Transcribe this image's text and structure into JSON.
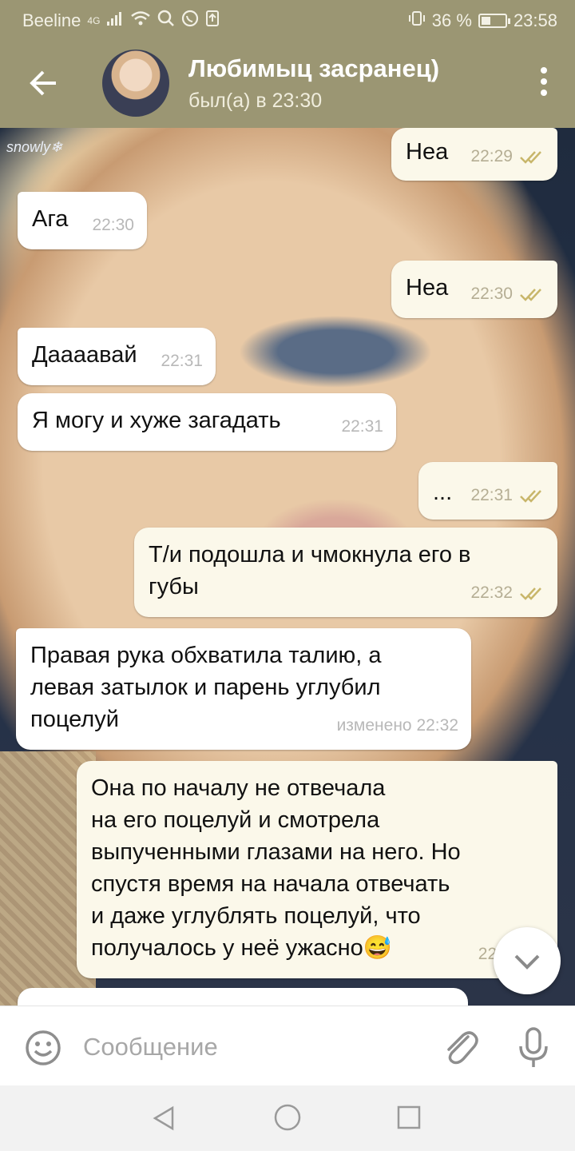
{
  "status_bar": {
    "carrier": "Beeline",
    "network": "4G",
    "battery": "36 %",
    "battery_level": 0.36,
    "time": "23:58"
  },
  "header": {
    "title": "Любимыц засранец)",
    "subtitle": "был(а) в 23:30"
  },
  "background_text": "snowly❄",
  "messages": [
    {
      "direction": "out",
      "text": "Неа",
      "time": "22:29",
      "read": true
    },
    {
      "direction": "in",
      "text": "Ага",
      "time": "22:30"
    },
    {
      "direction": "out",
      "text": "Неа",
      "time": "22:30",
      "read": true
    },
    {
      "direction": "in",
      "text": "Даааавай",
      "time": "22:31"
    },
    {
      "direction": "in",
      "text": "Я могу и хуже загадать",
      "time": "22:31"
    },
    {
      "direction": "out",
      "text": "...",
      "time": "22:31",
      "read": true
    },
    {
      "direction": "out",
      "text": "Т/и подошла и чмокнула его в\nгубы",
      "time": "22:32",
      "read": true
    },
    {
      "direction": "in",
      "text": "Правая рука обхватила талию,  а\nлевая затылок и парень углубил\nпоцелуй",
      "time": "изменено 22:32"
    },
    {
      "direction": "out",
      "text": "Она по началу не отвечала\nна его поцелуй и смотрела\nвыпученными глазами на него. Но\nспустя время на начала отвечать\nи даже углублять поцелуй, что\nполучалось у неё ужасно😅",
      "time": "22:"
    }
  ],
  "composer": {
    "placeholder": "Сообщение"
  },
  "colors": {
    "header_bg": "#9b9673",
    "bubble_out": "#fbf8ea",
    "bubble_in": "#ffffff",
    "tick": "#c8b66a"
  }
}
